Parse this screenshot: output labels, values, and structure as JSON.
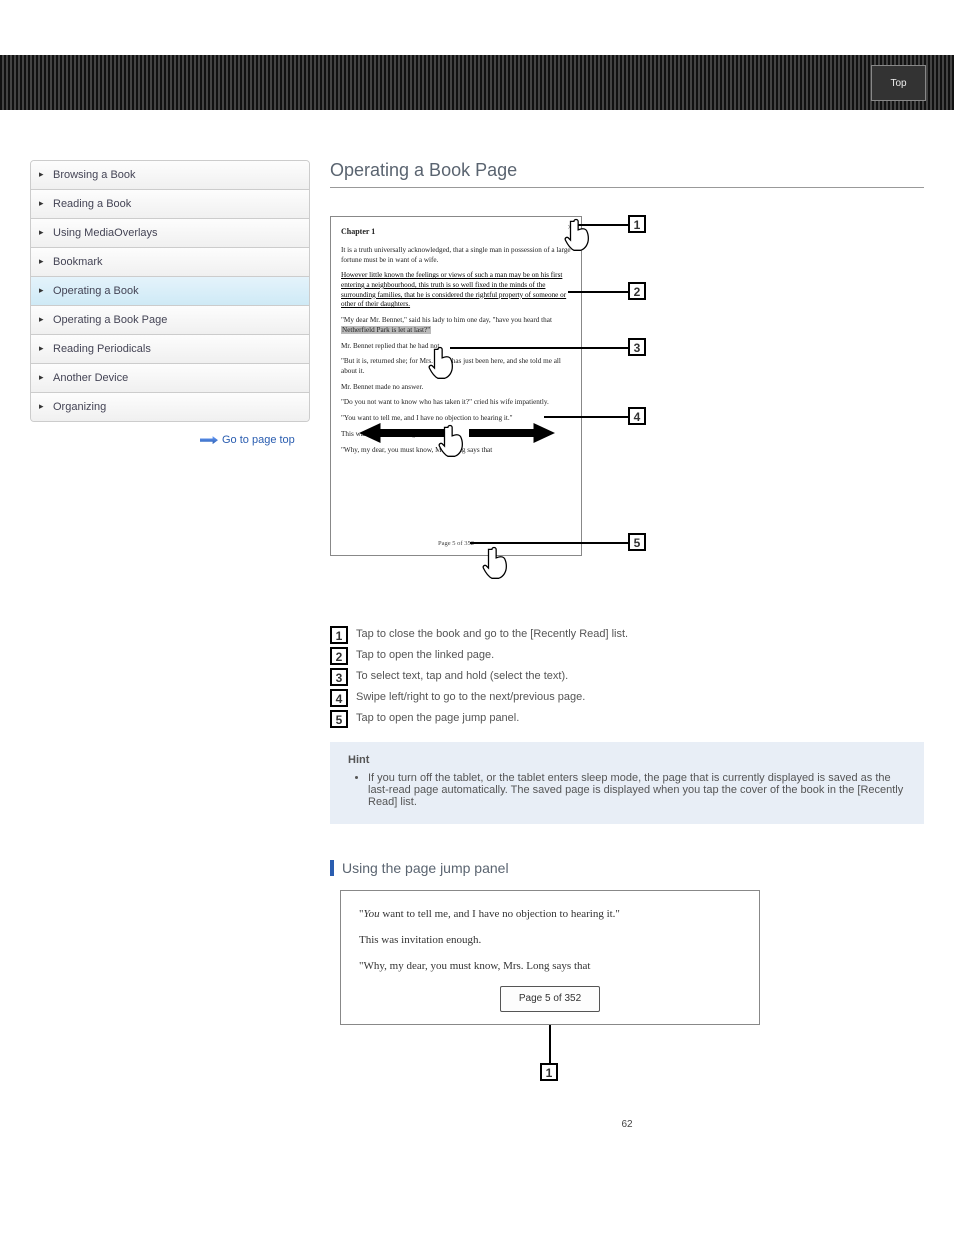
{
  "header": {
    "badge": "Top"
  },
  "sidebar": {
    "items": [
      {
        "label": "Browsing a Book"
      },
      {
        "label": "Reading a Book"
      },
      {
        "label": "Using MediaOverlays"
      },
      {
        "label": "Bookmark"
      },
      {
        "label": "Operating a Book"
      },
      {
        "label": "Operating a Book Page"
      },
      {
        "label": "Reading Periodicals"
      },
      {
        "label": "Another Device"
      },
      {
        "label": "Organizing"
      }
    ],
    "go_link": "Go to page top"
  },
  "main": {
    "title": "Operating a Book Page",
    "callouts": [
      {
        "n": "1",
        "text": "Tap to close the book and go to the [Recently Read] list.",
        "sub": ""
      },
      {
        "n": "2",
        "text": "Tap to open the linked page."
      },
      {
        "n": "3",
        "text": "To select text, tap and hold (select the text)."
      },
      {
        "n": "4",
        "text": "Swipe left/right to go to the next/previous page."
      },
      {
        "n": "5",
        "text": "Tap to open the page jump panel."
      }
    ],
    "hint": {
      "title": "Hint",
      "items": [
        "If you turn off the tablet, or the tablet enters sleep mode, the page that is currently displayed is saved as the last-read page automatically. The saved page is displayed when you tap the cover of the book in the [Recently Read] list."
      ]
    },
    "subsection_title": "Using the page jump panel",
    "reader_sample": {
      "chapter": "Chapter 1",
      "p1": "It is a truth universally acknowledged, that a single man in possession of a large fortune must be in want of a wife.",
      "p2": "However little known the feelings or views of such a man may be on his first entering a neighbourhood, this truth is so well fixed in the minds of the surrounding families, that he is considered the rightful property of someone or other of their daughters.",
      "p3a": "\"My dear Mr. Bennet,\" said his lady to him one day, \"have you heard that ",
      "p3_sel": "Netherfield Park is let at last?\"",
      "p4": "Mr. Bennet replied that he had not.",
      "p5": "\"But it is, returned she; for Mrs. Long has just been here, and she told me all about it.",
      "p6": "Mr. Bennet made no answer.",
      "p7": "\"Do you not want to know who has taken it?\" cried his wife impatiently.",
      "p8": "\"You want to tell me, and I have no objection to hearing it.\"",
      "p9": "This was invitation enough.",
      "p10": "\"Why, my dear, you must know, Mrs. Long says that",
      "page_ind": "Page 5 of 352"
    },
    "page_jump": {
      "p1_pre": "\"",
      "p1_ital": "You",
      "p1_post": " want to tell me, and I have no objection to hearing it.\"",
      "p2": "This was invitation enough.",
      "p3": "\"Why, my dear, you must know, Mrs. Long says that",
      "btn": "Page 5 of 352",
      "callout": "1"
    }
  },
  "footer": {
    "page_number": "62"
  }
}
